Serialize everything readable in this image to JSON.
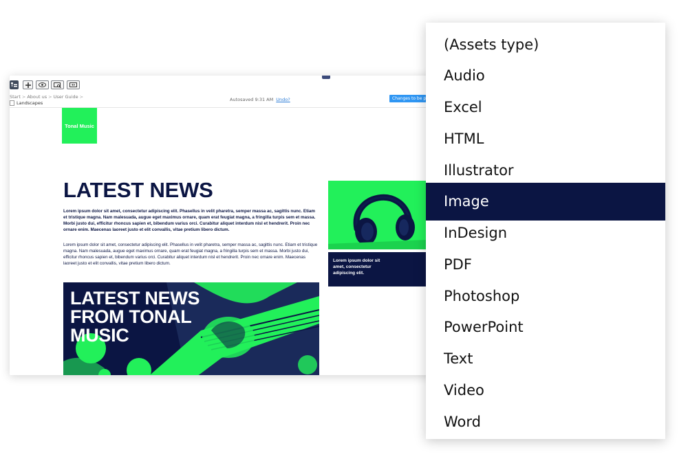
{
  "editor": {
    "breadcrumb": [
      "Start",
      "About us",
      "User Guide"
    ],
    "current_page": "Landscapes",
    "autosave_text": "Autosaved 9:31 AM",
    "undo_label": "Undo?",
    "changes_button": "Changes to be p"
  },
  "toolbar": {
    "icons": [
      "tree-icon",
      "plus-icon",
      "eye-icon",
      "preview-icon",
      "resize-icon"
    ]
  },
  "canvas": {
    "logo_text": "Tonal Music",
    "headline": "LATEST NEWS",
    "paragraph_bold": "Lorem ipsum dolor sit amet, consectetur adipiscing elit. Phasellus in velit pharetra, semper massa ac, sagittis nunc. Etiam et tristique magna. Nam malesuada, augue eget maximus ornare, quam erat feugiat magna, a fringilla turpis sem et massa. Morbi justo dui, efficitur rhoncus sapien et, bibendum varius orci. Curabitur aliquet interdum nisl et hendrerit. Proin nec ornare enim. Maecenas laoreet justo et elit convallis, vitae pretium libero dictum.",
    "paragraph_normal": "Lorem ipsum dolor sit amet, consectetur adipiscing elit. Phasellus in velit pharetra, semper massa ac, sagittis nunc. Etiam et tristique magna. Nam malesuada, augue eget maximus ornare, quam erat feugiat magna, a fringilla turpis sem et massa. Morbi justo dui, efficitur rhoncus sapien et, bibendum varius orci. Curabitur aliquet interdum nisl et hendrerit. Proin nec ornare enim. Maecenas laoreet justo et elit convallis, vitae pretium libero dictum.",
    "hero_lines": [
      "LATEST NEWS",
      "FROM TONAL",
      "MUSIC"
    ],
    "caption": "Lorem ipsum dolor sit amet, consectetur adipiscing elit."
  },
  "dropdown": {
    "selected_index": 5,
    "items": [
      "(Assets type)",
      "Audio",
      "Excel",
      "HTML",
      "Illustrator",
      "Image",
      "InDesign",
      "PDF",
      "Photoshop",
      "PowerPoint",
      "Text",
      "Video",
      "Word"
    ]
  },
  "colors": {
    "navy": "#0b1543",
    "green": "#22f05a",
    "accent_blue": "#2f96f3"
  }
}
